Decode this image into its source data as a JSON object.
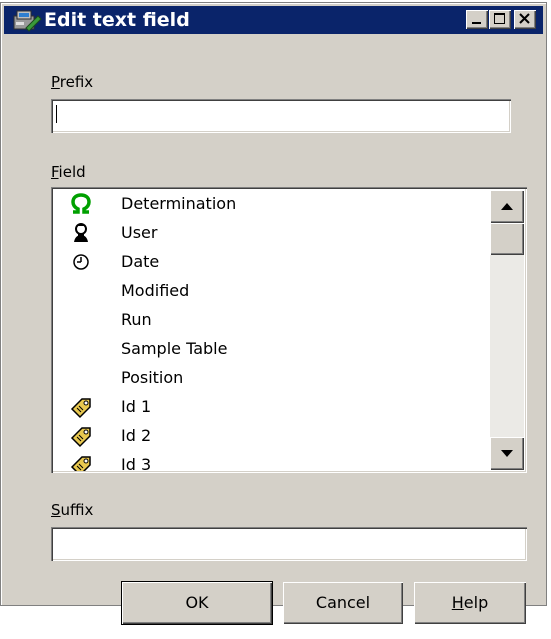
{
  "window": {
    "title": "Edit text field"
  },
  "titlebar_buttons": {
    "minimize": "minimize",
    "maximize": "maximize",
    "close": "close"
  },
  "prefix": {
    "label_accel": "P",
    "label_rest": "refix",
    "value": ""
  },
  "field": {
    "label_accel": "F",
    "label_rest": "ield",
    "items": [
      {
        "label": "Determination",
        "icon": "omega-icon"
      },
      {
        "label": "User",
        "icon": "user-icon"
      },
      {
        "label": "Date",
        "icon": "clock-icon"
      },
      {
        "label": "Modified",
        "icon": ""
      },
      {
        "label": "Run",
        "icon": ""
      },
      {
        "label": "Sample Table",
        "icon": ""
      },
      {
        "label": "Position",
        "icon": ""
      },
      {
        "label": "Id 1",
        "icon": "tag-icon"
      },
      {
        "label": "Id 2",
        "icon": "tag-icon"
      },
      {
        "label": "Id 3",
        "icon": "tag-icon"
      }
    ]
  },
  "suffix": {
    "label_accel": "S",
    "label_rest": "uffix",
    "value": ""
  },
  "buttons": {
    "ok": "OK",
    "cancel": "Cancel",
    "help_accel": "H",
    "help_rest": "elp"
  },
  "colors": {
    "titlebar": "#0a246a",
    "dialog_bg": "#d4d0c8",
    "omega": "#00a000"
  }
}
